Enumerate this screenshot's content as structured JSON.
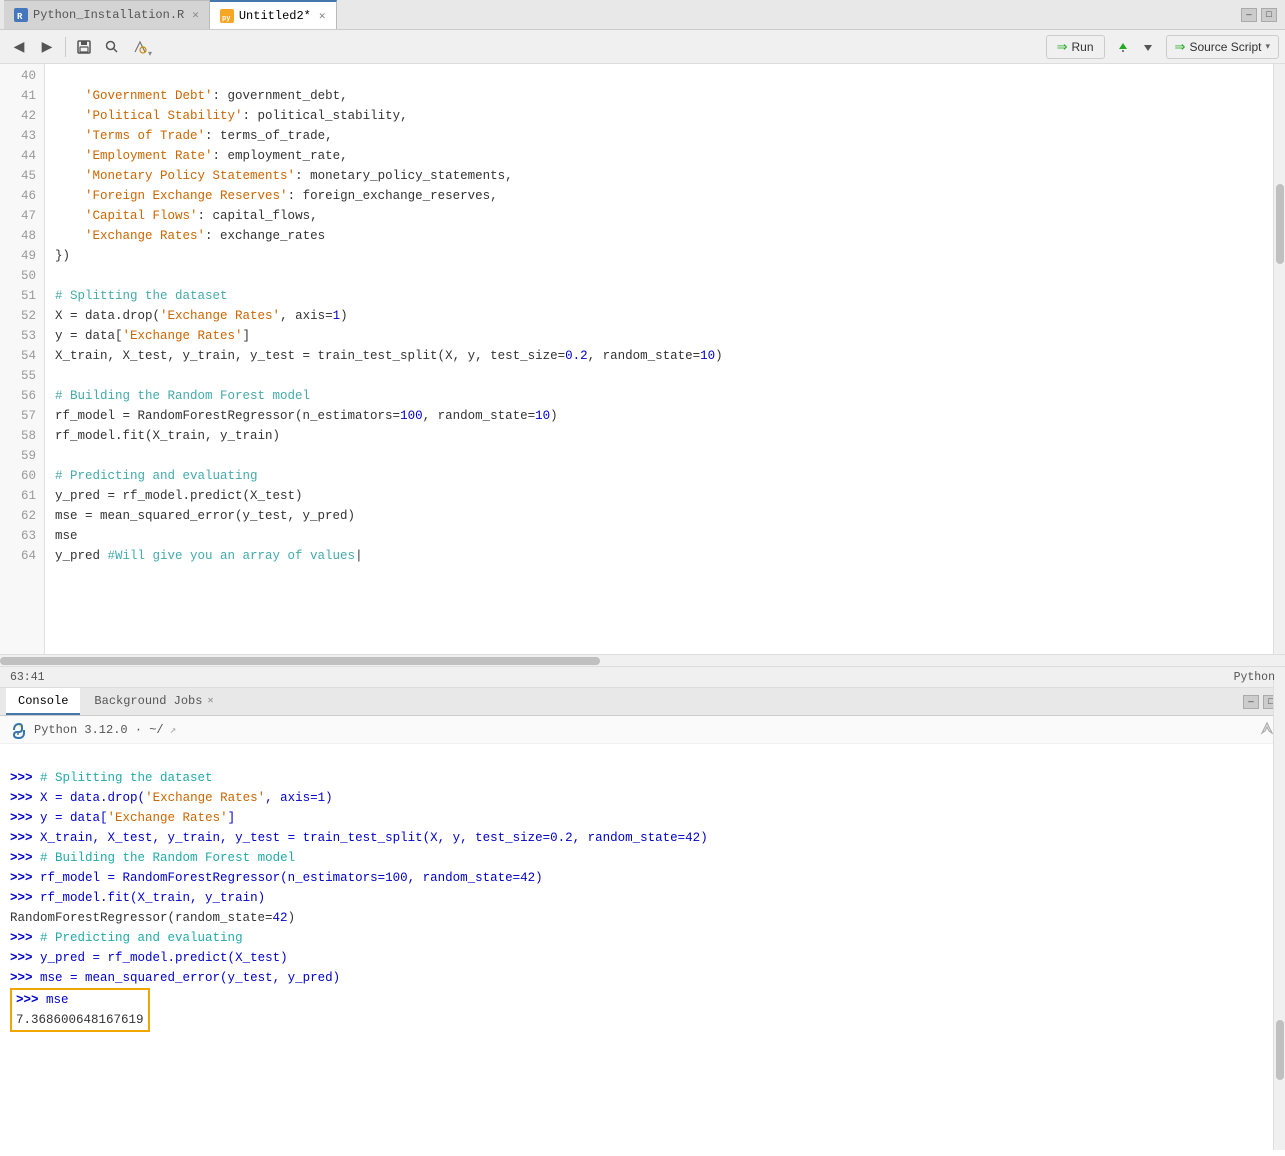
{
  "tabs": [
    {
      "id": "tab1",
      "label": "Python_Installation.R",
      "active": false,
      "icon": "R"
    },
    {
      "id": "tab2",
      "label": "Untitled2*",
      "active": true,
      "icon": "py"
    }
  ],
  "toolbar": {
    "run_label": "Run",
    "source_label": "Source Script"
  },
  "editor": {
    "lines": [
      {
        "num": 40,
        "code": "    'Government Debt': government_debt,"
      },
      {
        "num": 41,
        "code": "    'Political Stability': political_stability,"
      },
      {
        "num": 42,
        "code": "    'Terms of Trade': terms_of_trade,"
      },
      {
        "num": 43,
        "code": "    'Employment Rate': employment_rate,"
      },
      {
        "num": 44,
        "code": "    'Monetary Policy Statements': monetary_policy_statements,"
      },
      {
        "num": 45,
        "code": "    'Foreign Exchange Reserves': foreign_exchange_reserves,"
      },
      {
        "num": 46,
        "code": "    'Capital Flows': capital_flows,"
      },
      {
        "num": 47,
        "code": "    'Exchange Rates': exchange_rates"
      },
      {
        "num": 48,
        "code": "})"
      },
      {
        "num": 49,
        "code": ""
      },
      {
        "num": 50,
        "code": "# Splitting the dataset"
      },
      {
        "num": 51,
        "code": "X = data.drop('Exchange Rates', axis=1)"
      },
      {
        "num": 52,
        "code": "y = data['Exchange Rates']"
      },
      {
        "num": 53,
        "code": "X_train, X_test, y_train, y_test = train_test_split(X, y, test_size=0.2, random_state=10)"
      },
      {
        "num": 54,
        "code": ""
      },
      {
        "num": 55,
        "code": "# Building the Random Forest model"
      },
      {
        "num": 56,
        "code": "rf_model = RandomForestRegressor(n_estimators=100, random_state=10)"
      },
      {
        "num": 57,
        "code": "rf_model.fit(X_train, y_train)"
      },
      {
        "num": 58,
        "code": ""
      },
      {
        "num": 59,
        "code": "# Predicting and evaluating"
      },
      {
        "num": 60,
        "code": "y_pred = rf_model.predict(X_test)"
      },
      {
        "num": 61,
        "code": "mse = mean_squared_error(y_test, y_pred)"
      },
      {
        "num": 62,
        "code": "mse"
      },
      {
        "num": 63,
        "code": "y_pred #Will give you an array of values|"
      },
      {
        "num": 64,
        "code": ""
      }
    ]
  },
  "status_bar": {
    "position": "63:41",
    "language": "Python"
  },
  "console": {
    "tab_label": "Console",
    "bg_jobs_label": "Background Jobs",
    "python_version": "Python 3.12.0",
    "working_dir": "~/",
    "output_lines": [
      {
        "type": "prompt_comment",
        "text": ">>> # Splitting the dataset"
      },
      {
        "type": "prompt_code",
        "text": ">>> X = data.drop('Exchange Rates', axis=1)"
      },
      {
        "type": "prompt_code",
        "text": ">>> y = data['Exchange Rates']"
      },
      {
        "type": "prompt_code",
        "text": ">>> X_train, X_test, y_train, y_test = train_test_split(X, y, test_size=0.2, random_state=42)"
      },
      {
        "type": "prompt_comment",
        "text": ">>> # Building the Random Forest model"
      },
      {
        "type": "prompt_code",
        "text": ">>> rf_model = RandomForestRegressor(n_estimators=100, random_state=42)"
      },
      {
        "type": "prompt_code",
        "text": ">>> rf_model.fit(X_train, y_train)"
      },
      {
        "type": "output",
        "text": "RandomForestRegressor(random_state=42)"
      },
      {
        "type": "prompt_comment",
        "text": ">>> # Predicting and evaluating"
      },
      {
        "type": "prompt_code",
        "text": ">>> y_pred = rf_model.predict(X_test)"
      },
      {
        "type": "prompt_code",
        "text": ">>> mse = mean_squared_error(y_test, y_pred)"
      }
    ],
    "highlighted_mse_line": ">>> mse",
    "mse_result": "7.368600648167619"
  }
}
